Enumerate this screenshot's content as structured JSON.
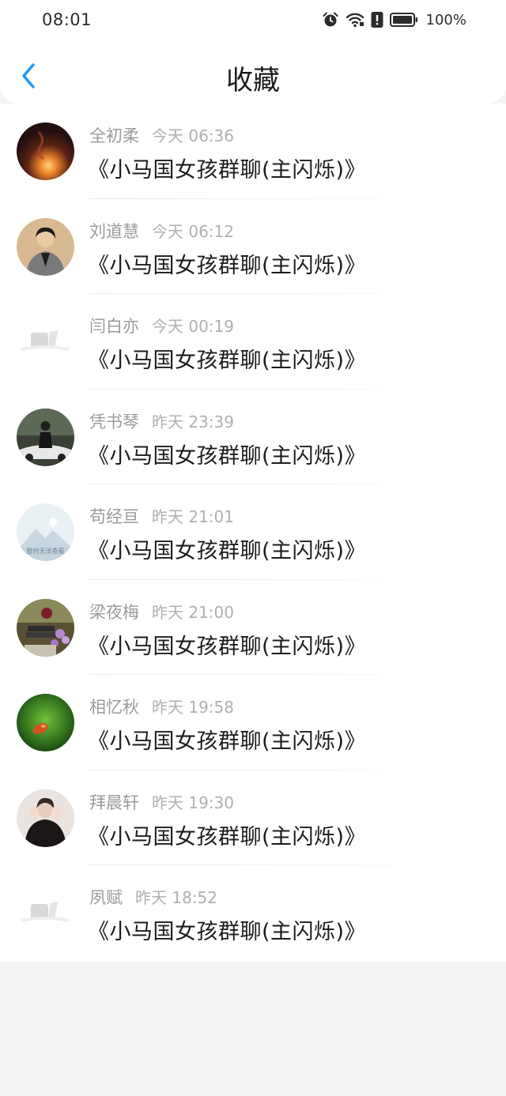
{
  "status_bar": {
    "time": "08:01",
    "battery": "100%",
    "icons": [
      "alarm-icon",
      "wifi-icon",
      "alert-icon",
      "battery-icon"
    ]
  },
  "header": {
    "title": "收藏",
    "back_icon": "chevron-left-icon",
    "accent_color": "#2196f3"
  },
  "favorites": [
    {
      "name": "全初柔",
      "time": "今天 06:36",
      "content": "《小马国女孩群聊(主闪烁)》",
      "avatar": "avatar-dark-fire"
    },
    {
      "name": "刘道慧",
      "time": "今天 06:12",
      "content": "《小马国女孩群聊(主闪烁)》",
      "avatar": "avatar-person-blazer"
    },
    {
      "name": "闫白亦",
      "time": "今天 00:19",
      "content": "《小马国女孩群聊(主闪烁)》",
      "avatar": "avatar-placeholder-faded"
    },
    {
      "name": "凭书琴",
      "time": "昨天 23:39",
      "content": "《小马国女孩群聊(主闪烁)》",
      "avatar": "avatar-person-car"
    },
    {
      "name": "苟经亘",
      "time": "昨天 21:01",
      "content": "《小马国女孩群聊(主闪烁)》",
      "avatar": "avatar-image-unavailable"
    },
    {
      "name": "梁夜梅",
      "time": "昨天 21:00",
      "content": "《小马国女孩群聊(主闪烁)》",
      "avatar": "avatar-flowers-books"
    },
    {
      "name": "相忆秋",
      "time": "昨天 19:58",
      "content": "《小马国女孩群聊(主闪烁)》",
      "avatar": "avatar-green-moss"
    },
    {
      "name": "拜晨轩",
      "time": "昨天 19:30",
      "content": "《小马国女孩群聊(主闪烁)》",
      "avatar": "avatar-person-hands"
    },
    {
      "name": "夙赋",
      "time": "昨天 18:52",
      "content": "《小马国女孩群聊(主闪烁)》",
      "avatar": "avatar-placeholder-faded"
    }
  ],
  "placeholder_caption": "暂时无法查看"
}
